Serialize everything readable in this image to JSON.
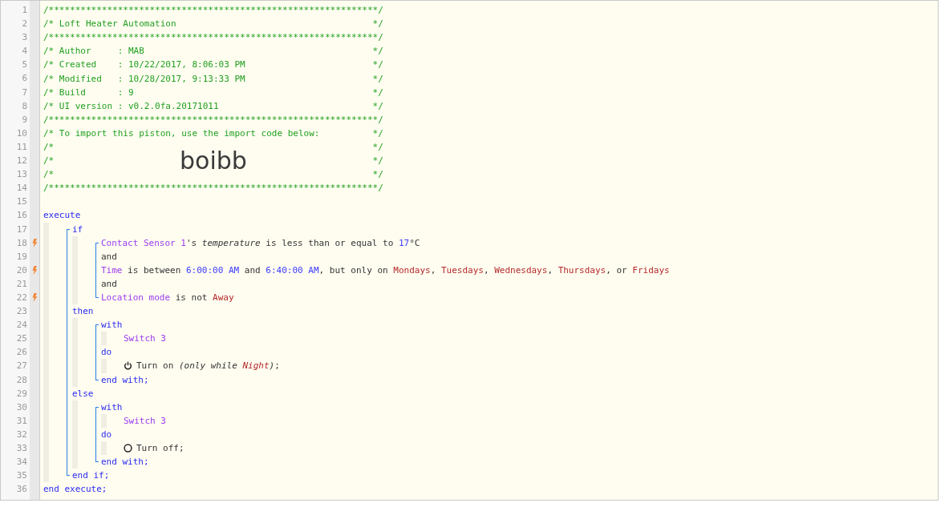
{
  "lines": [
    {
      "number": "1",
      "trigger": false,
      "kind": "banner",
      "segments": [
        {
          "kind": "comment",
          "text": "/**************************************************************/"
        }
      ]
    },
    {
      "number": "2",
      "trigger": false,
      "kind": "banner",
      "segments": [
        {
          "kind": "comment",
          "text": "/* Loft Heater Automation"
        },
        {
          "kind": "comment",
          "text": "*/"
        }
      ]
    },
    {
      "number": "3",
      "trigger": false,
      "kind": "banner",
      "segments": [
        {
          "kind": "comment",
          "text": "/**************************************************************/"
        }
      ]
    },
    {
      "number": "4",
      "trigger": false,
      "kind": "banner",
      "segments": [
        {
          "kind": "comment",
          "text": "/* Author     : MAB"
        },
        {
          "kind": "comment",
          "text": "*/"
        }
      ]
    },
    {
      "number": "5",
      "trigger": false,
      "kind": "banner",
      "segments": [
        {
          "kind": "comment",
          "text": "/* Created    : 10/22/2017, 8:06:03 PM"
        },
        {
          "kind": "comment",
          "text": "*/"
        }
      ]
    },
    {
      "number": "6",
      "trigger": false,
      "kind": "banner",
      "segments": [
        {
          "kind": "comment",
          "text": "/* Modified   : 10/28/2017, 9:13:33 PM"
        },
        {
          "kind": "comment",
          "text": "*/"
        }
      ]
    },
    {
      "number": "7",
      "trigger": false,
      "kind": "banner",
      "segments": [
        {
          "kind": "comment",
          "text": "/* Build      : 9"
        },
        {
          "kind": "comment",
          "text": "*/"
        }
      ]
    },
    {
      "number": "8",
      "trigger": false,
      "kind": "banner",
      "segments": [
        {
          "kind": "comment",
          "text": "/* UI version : v0.2.0fa.20171011"
        },
        {
          "kind": "comment",
          "text": "*/"
        }
      ]
    },
    {
      "number": "9",
      "trigger": false,
      "kind": "banner",
      "segments": [
        {
          "kind": "comment",
          "text": "/**************************************************************/"
        }
      ]
    },
    {
      "number": "10",
      "trigger": false,
      "kind": "banner",
      "segments": [
        {
          "kind": "comment",
          "text": "/* To import this piston, use the import code below:"
        },
        {
          "kind": "comment",
          "text": "*/"
        }
      ]
    },
    {
      "number": "11",
      "trigger": false,
      "kind": "banner",
      "segments": [
        {
          "kind": "comment",
          "text": "/*"
        },
        {
          "kind": "comment",
          "text": "*/"
        }
      ]
    },
    {
      "number": "12",
      "trigger": false,
      "kind": "banner",
      "segments": [
        {
          "kind": "comment",
          "text": "/*"
        },
        {
          "kind": "import-code",
          "text": "boibb"
        },
        {
          "kind": "comment",
          "text": "*/"
        }
      ]
    },
    {
      "number": "13",
      "trigger": false,
      "kind": "banner",
      "segments": [
        {
          "kind": "comment",
          "text": "/*"
        },
        {
          "kind": "comment",
          "text": "*/"
        }
      ]
    },
    {
      "number": "14",
      "trigger": false,
      "kind": "banner",
      "segments": [
        {
          "kind": "comment",
          "text": "/**************************************************************/"
        }
      ]
    },
    {
      "number": "15",
      "trigger": false,
      "kind": "code"
    },
    {
      "number": "16",
      "trigger": false,
      "kind": "code",
      "segments": [
        {
          "kind": "keyword",
          "text": "execute"
        }
      ],
      "children": [
        {
          "number": "17",
          "trigger": false,
          "kind": "code",
          "segments": [
            {
              "kind": "keyword",
              "text": "if"
            }
          ],
          "children": [
            {
              "number": "18",
              "trigger": true,
              "kind": "code",
              "segments": [
                {
                  "kind": "device",
                  "text": "Contact Sensor 1"
                },
                {
                  "kind": "text",
                  "text": "'s "
                },
                {
                  "kind": "italic",
                  "text": "temperature"
                },
                {
                  "kind": "text",
                  "text": " is less than or equal to "
                },
                {
                  "kind": "value",
                  "text": "17"
                },
                {
                  "kind": "text",
                  "text": "°C"
                }
              ]
            },
            {
              "number": "19",
              "trigger": false,
              "kind": "code",
              "segments": [
                {
                  "kind": "text",
                  "text": "and"
                }
              ]
            },
            {
              "number": "20",
              "trigger": true,
              "kind": "code",
              "segments": [
                {
                  "kind": "device",
                  "text": "Time"
                },
                {
                  "kind": "text",
                  "text": " is between "
                },
                {
                  "kind": "value",
                  "text": "6:00:00 AM"
                },
                {
                  "kind": "text",
                  "text": " and "
                },
                {
                  "kind": "value",
                  "text": "6:40:00 AM"
                },
                {
                  "kind": "text",
                  "text": ", but only on "
                },
                {
                  "kind": "string",
                  "text": "Mondays"
                },
                {
                  "kind": "text",
                  "text": ", "
                },
                {
                  "kind": "string",
                  "text": "Tuesdays"
                },
                {
                  "kind": "text",
                  "text": ", "
                },
                {
                  "kind": "string",
                  "text": "Wednesdays"
                },
                {
                  "kind": "text",
                  "text": ", "
                },
                {
                  "kind": "string",
                  "text": "Thursdays"
                },
                {
                  "kind": "text",
                  "text": ", or "
                },
                {
                  "kind": "string",
                  "text": "Fridays"
                }
              ]
            },
            {
              "number": "21",
              "trigger": false,
              "kind": "code",
              "segments": [
                {
                  "kind": "text",
                  "text": "and"
                }
              ]
            },
            {
              "number": "22",
              "trigger": true,
              "kind": "code",
              "segments": [
                {
                  "kind": "device",
                  "text": "Location mode"
                },
                {
                  "kind": "text",
                  "text": " is not "
                },
                {
                  "kind": "string",
                  "text": "Away"
                }
              ]
            }
          ]
        },
        {
          "number": "23",
          "trigger": false,
          "kind": "code",
          "segments": [
            {
              "kind": "keyword",
              "text": "then"
            }
          ],
          "children": [
            {
              "number": "24",
              "trigger": false,
              "kind": "code",
              "segments": [
                {
                  "kind": "keyword",
                  "text": "with"
                }
              ],
              "children": [
                {
                  "number": "25",
                  "trigger": false,
                  "kind": "code",
                  "segments": [
                    {
                      "kind": "device",
                      "text": "Switch 3"
                    }
                  ]
                }
              ]
            },
            {
              "number": "26",
              "trigger": false,
              "kind": "code",
              "segments": [
                {
                  "kind": "keyword",
                  "text": "do"
                }
              ],
              "children": [
                {
                  "number": "27",
                  "trigger": false,
                  "kind": "code",
                  "segments": [
                    {
                      "kind": "power-icon"
                    },
                    {
                      "kind": "text",
                      "text": "Turn on "
                    },
                    {
                      "kind": "italic",
                      "text": "(only while "
                    },
                    {
                      "kind": "italic-string",
                      "text": "Night"
                    },
                    {
                      "kind": "italic",
                      "text": ")"
                    },
                    {
                      "kind": "text",
                      "text": ";"
                    }
                  ]
                }
              ]
            },
            {
              "number": "28",
              "trigger": false,
              "kind": "code",
              "segments": [
                {
                  "kind": "keyword",
                  "text": "end with;"
                }
              ]
            }
          ]
        },
        {
          "number": "29",
          "trigger": false,
          "kind": "code",
          "segments": [
            {
              "kind": "keyword",
              "text": "else"
            }
          ],
          "children": [
            {
              "number": "30",
              "trigger": false,
              "kind": "code",
              "segments": [
                {
                  "kind": "keyword",
                  "text": "with"
                }
              ],
              "children": [
                {
                  "number": "31",
                  "trigger": false,
                  "kind": "code",
                  "segments": [
                    {
                      "kind": "device",
                      "text": "Switch 3"
                    }
                  ]
                }
              ]
            },
            {
              "number": "32",
              "trigger": false,
              "kind": "code",
              "segments": [
                {
                  "kind": "keyword",
                  "text": "do"
                }
              ],
              "children": [
                {
                  "number": "33",
                  "trigger": false,
                  "kind": "code",
                  "segments": [
                    {
                      "kind": "off-icon"
                    },
                    {
                      "kind": "text",
                      "text": "Turn off;"
                    }
                  ]
                }
              ]
            },
            {
              "number": "34",
              "trigger": false,
              "kind": "code",
              "segments": [
                {
                  "kind": "keyword",
                  "text": "end with;"
                }
              ]
            }
          ]
        },
        {
          "number": "35",
          "trigger": false,
          "kind": "code",
          "segments": [
            {
              "kind": "keyword",
              "text": "end if;"
            }
          ]
        }
      ]
    },
    {
      "number": "36",
      "trigger": false,
      "kind": "code",
      "segments": [
        {
          "kind": "keyword",
          "text": "end execute;"
        }
      ]
    }
  ]
}
